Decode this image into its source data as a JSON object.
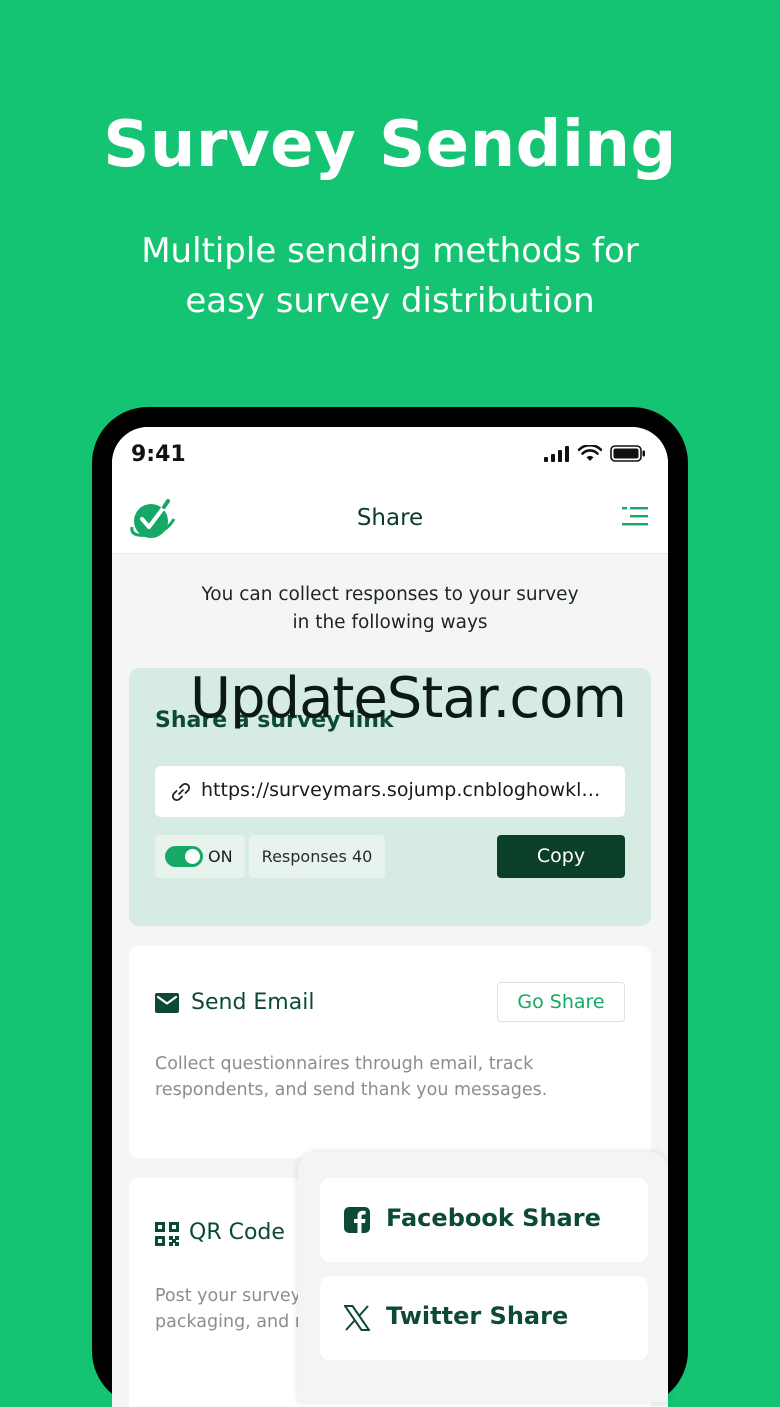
{
  "hero": {
    "title": "Survey Sending",
    "subtitle_line1": "Multiple sending methods for",
    "subtitle_line2": "easy survey distribution"
  },
  "status_bar": {
    "time": "9:41"
  },
  "nav": {
    "title": "Share"
  },
  "intro": {
    "line1": "You can collect responses to your survey",
    "line2": "in the following ways"
  },
  "share_link": {
    "title": "Share a survey link",
    "url": "https://surveymars.sojump.cnbloghowkls...",
    "toggle_label": "ON",
    "toggle_on": true,
    "responses_label": "Responses",
    "responses_count": "40",
    "copy_label": "Copy"
  },
  "send_email": {
    "title": "Send Email",
    "button": "Go Share",
    "description": "Collect questionnaires through email, track respondents, and send thank you messages."
  },
  "qr_code": {
    "title": "QR Code",
    "description_line1": "Post your survey",
    "description_line2": "packaging, and r"
  },
  "popover": {
    "items": [
      {
        "label": "Facebook Share",
        "icon": "facebook-icon"
      },
      {
        "label": "Twitter Share",
        "icon": "x-twitter-icon"
      }
    ]
  },
  "watermark": "UpdateStar.com",
  "colors": {
    "background": "#14c472",
    "accent": "#16a866",
    "dark_green": "#0c3f2a",
    "link_card": "#d6ece2"
  }
}
